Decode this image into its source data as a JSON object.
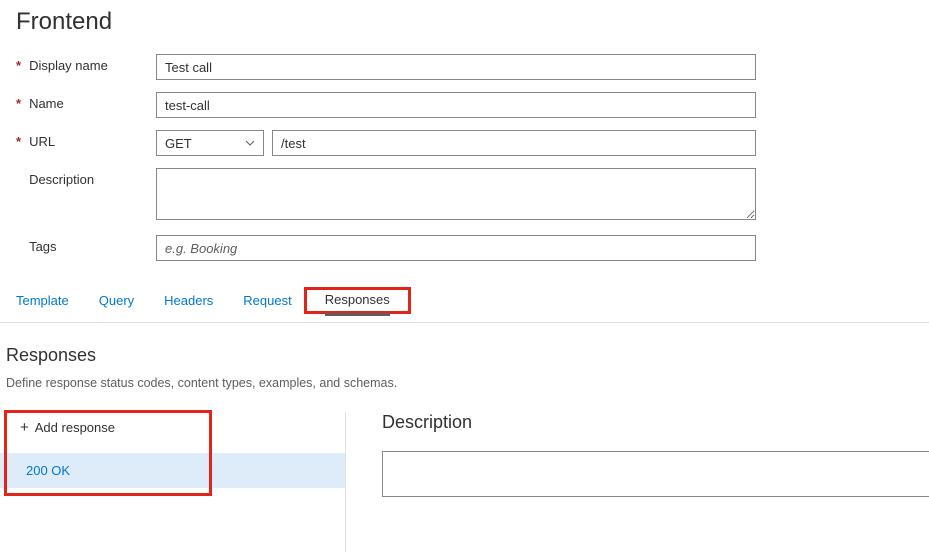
{
  "title": "Frontend",
  "form": {
    "displayName": {
      "label": "Display name",
      "value": "Test call",
      "required": true
    },
    "name": {
      "label": "Name",
      "value": "test-call",
      "required": true
    },
    "url": {
      "label": "URL",
      "method": "GET",
      "path": "/test",
      "required": true
    },
    "description": {
      "label": "Description",
      "value": ""
    },
    "tags": {
      "label": "Tags",
      "value": "",
      "placeholder": "e.g. Booking"
    }
  },
  "tabs": {
    "template": "Template",
    "query": "Query",
    "headers": "Headers",
    "request": "Request",
    "responses": "Responses",
    "active": "responses"
  },
  "responses": {
    "sectionTitle": "Responses",
    "subtitle": "Define response status codes, content types, examples, and schemas.",
    "addLabel": "Add response",
    "items": [
      {
        "label": "200 OK"
      }
    ],
    "detail": {
      "descriptionLabel": "Description",
      "descriptionValue": ""
    }
  }
}
